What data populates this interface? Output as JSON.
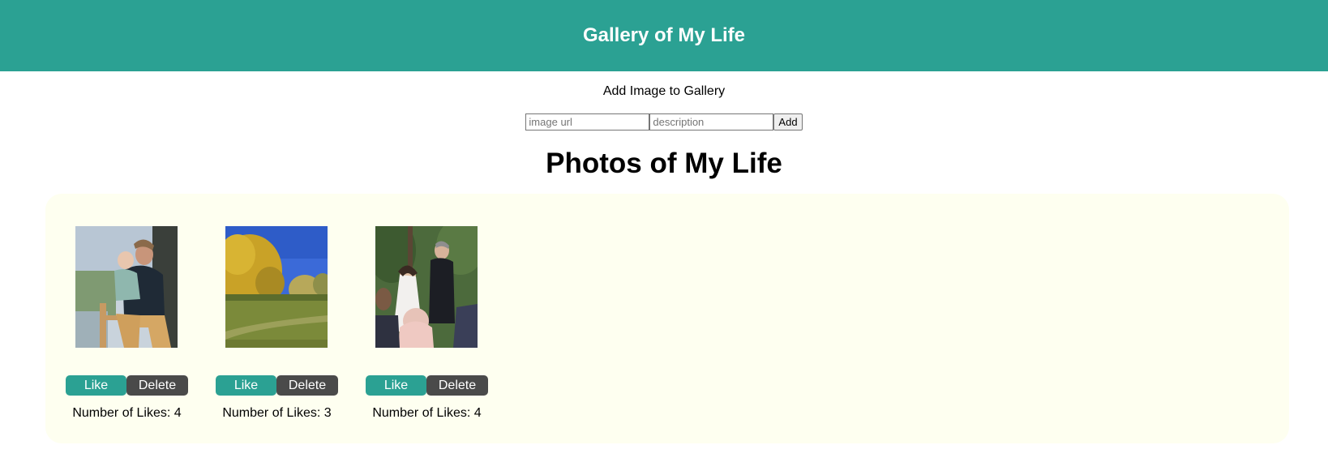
{
  "header": {
    "title": "Gallery of My Life"
  },
  "add_form": {
    "label": "Add Image to Gallery",
    "url_placeholder": "image url",
    "description_placeholder": "description",
    "add_label": "Add"
  },
  "gallery": {
    "title": "Photos of My Life",
    "likes_prefix": "Number of Likes: ",
    "photos": [
      {
        "like_label": "Like",
        "delete_label": "Delete",
        "likes": "4"
      },
      {
        "like_label": "Like",
        "delete_label": "Delete",
        "likes": "3"
      },
      {
        "like_label": "Like",
        "delete_label": "Delete",
        "likes": "4"
      }
    ]
  },
  "colors": {
    "accent": "#2ba193",
    "delete": "#4a4a4a",
    "gallery_bg": "#fefff0"
  }
}
